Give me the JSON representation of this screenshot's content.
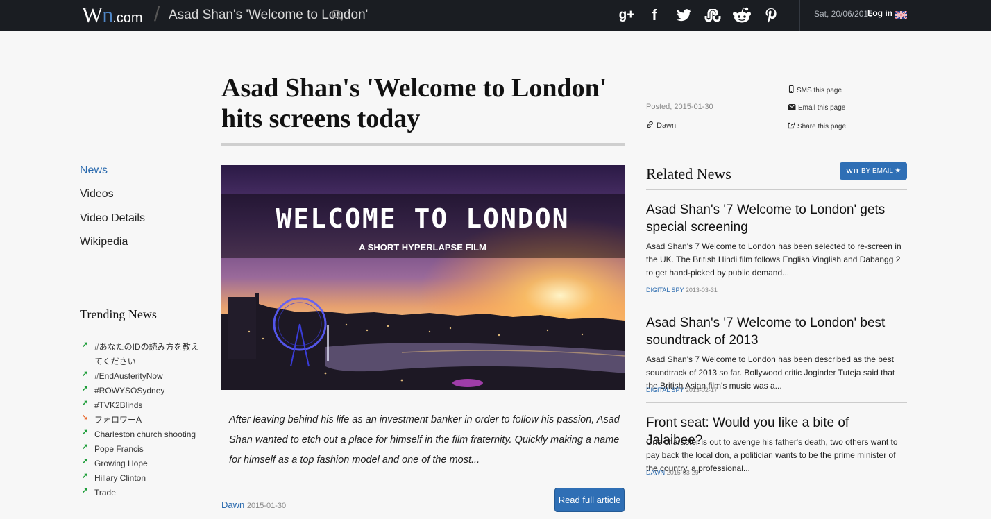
{
  "topbar": {
    "logo_w": "W",
    "logo_n": "n",
    "logo_com": ".com",
    "page_title": "Asad Shan's 'Welcome to London'",
    "date": "Sat, 20/06/2015",
    "login": "Log in",
    "social": [
      {
        "name": "google-plus-icon",
        "glyph": "g+"
      },
      {
        "name": "facebook-icon",
        "glyph": "f"
      },
      {
        "name": "twitter-icon",
        "glyph": ""
      },
      {
        "name": "stumbleupon-icon",
        "glyph": "su"
      },
      {
        "name": "reddit-icon",
        "glyph": ""
      },
      {
        "name": "pinterest-icon",
        "glyph": "p"
      }
    ]
  },
  "nav": {
    "items": [
      "News",
      "Videos",
      "Video Details",
      "Wikipedia"
    ],
    "active": 0
  },
  "trending": {
    "heading": "Trending News",
    "items": [
      {
        "text": "#あなたのIDの読み方を教えてください",
        "trend": "up"
      },
      {
        "text": "#EndAusterityNow",
        "trend": "up"
      },
      {
        "text": "#ROWYSOSydney",
        "trend": "up"
      },
      {
        "text": "#TVK2Blinds",
        "trend": "up"
      },
      {
        "text": "フォロワーA",
        "trend": "down"
      },
      {
        "text": "Charleston church shooting",
        "trend": "up"
      },
      {
        "text": "Pope Francis",
        "trend": "up"
      },
      {
        "text": "Growing Hope",
        "trend": "up"
      },
      {
        "text": "Hillary Clinton",
        "trend": "up"
      },
      {
        "text": "Trade",
        "trend": "up"
      }
    ],
    "colors": {
      "up": "#1e9e3a",
      "down": "#e8692e"
    }
  },
  "article": {
    "headline": "Asad Shan's 'Welcome to London' hits screens today",
    "hero_title": "WELCOME TO LONDON",
    "hero_subtitle": "A SHORT HYPERLAPSE FILM",
    "excerpt": "After leaving behind his life as an investment banker in order to follow his passion, Asad Shan wanted to etch out a place for himself in the film fraternity. Quickly making a name for himself as a top fashion model and one of the most...",
    "source": "Dawn",
    "date": "2015-01-30",
    "read_more": "Read full article"
  },
  "meta": {
    "posted": "Posted, 2015-01-30",
    "author": "Dawn",
    "share": [
      {
        "icon": "phone-icon",
        "label": "SMS this page"
      },
      {
        "icon": "envelope-icon",
        "label": "Email this page"
      },
      {
        "icon": "share-icon",
        "label": "Share this page"
      }
    ]
  },
  "related": {
    "heading": "Related News",
    "email_wn": "wn",
    "email_label": "BY EMAIL ★",
    "items": [
      {
        "title": "Asad Shan's '7 Welcome to London' gets special screening",
        "summary": "Asad Shan's 7 Welcome to London has been selected to re-screen in the UK. The British Hindi film follows English Vinglish and Dabangg 2 to get hand-picked by public demand...",
        "source": "DIGITAL SPY",
        "date": "2013-03-31"
      },
      {
        "title": "Asad Shan's '7 Welcome to London' best soundtrack of 2013",
        "summary": "Asad Shan's 7 Welcome to London has been described as the best soundtrack of 2013 so far. Bollywood critic Joginder Tuteja said that the British Asian film's music was a...",
        "source": "DIGITAL SPY",
        "date": "2013-02-17"
      },
      {
        "title": "Front seat: Would you like a bite of Jalaibee?",
        "summary": "One character is out to avenge his father's death, two others want to pay back the local don, a politician wants to be the prime minister of the country, a professional...",
        "source": "DAWN",
        "date": "2015-03-29"
      }
    ]
  },
  "colors": {
    "topbar": "#1a1d22",
    "accent": "#2f6fb5",
    "link": "#2a6aae"
  }
}
